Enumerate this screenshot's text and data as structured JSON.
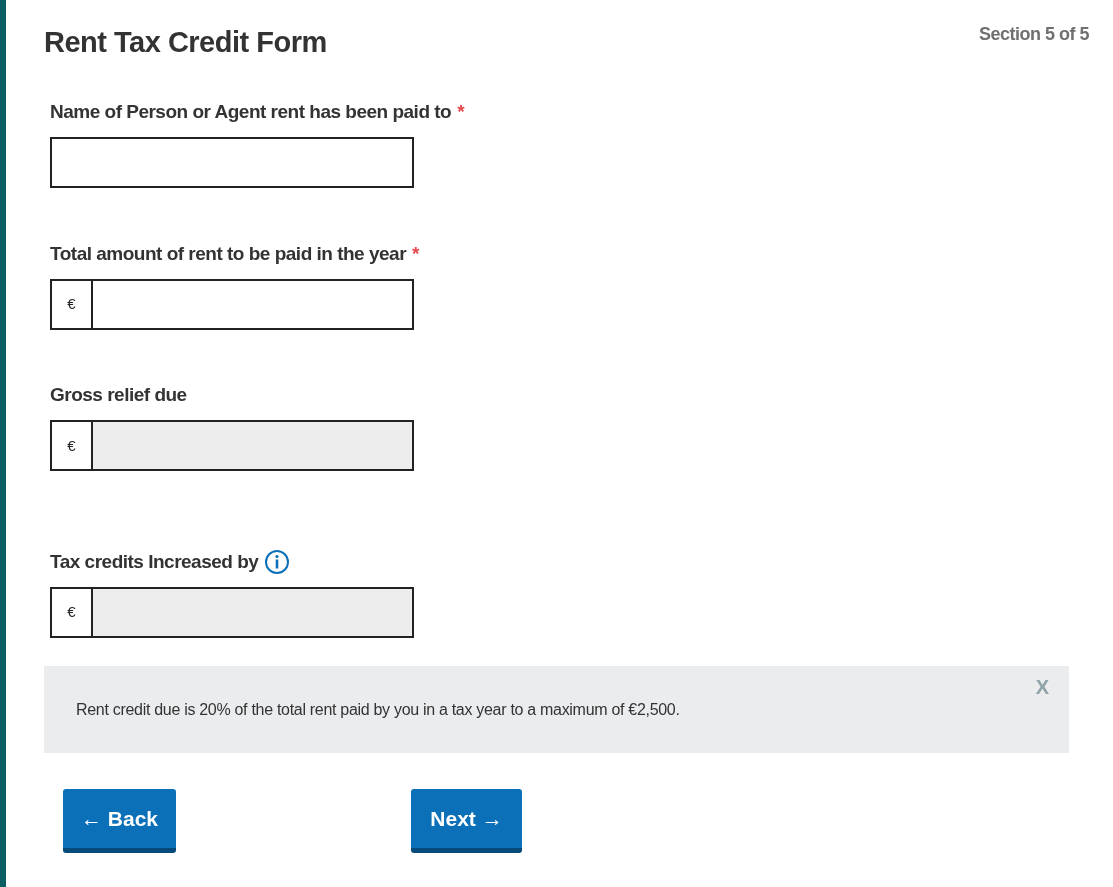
{
  "title": "Rent Tax Credit Form",
  "section": "Section 5 of 5",
  "fields": [
    {
      "label": "Name of Person or Agent rent has been paid to",
      "required": true,
      "info": false,
      "disabled": false
    },
    {
      "label": "Total amount of rent to be paid in the year",
      "required": true,
      "info": false,
      "prefix": "€",
      "disabled": false
    },
    {
      "label": "Gross relief due",
      "required": false,
      "info": false,
      "prefix": "€",
      "disabled": true
    },
    {
      "label": "Tax credits Increased by",
      "required": false,
      "info": true,
      "prefix": "€",
      "disabled": true
    }
  ],
  "required_mark": "*",
  "notice": {
    "text": "Rent credit due is 20% of the total rent paid by you in a tax year to a maximum of €2,500.",
    "close": "X"
  },
  "buttons": [
    {
      "label": "Back",
      "arrow": "←",
      "kind": "back"
    },
    {
      "label": "Next",
      "arrow": "→",
      "kind": "next"
    }
  ]
}
